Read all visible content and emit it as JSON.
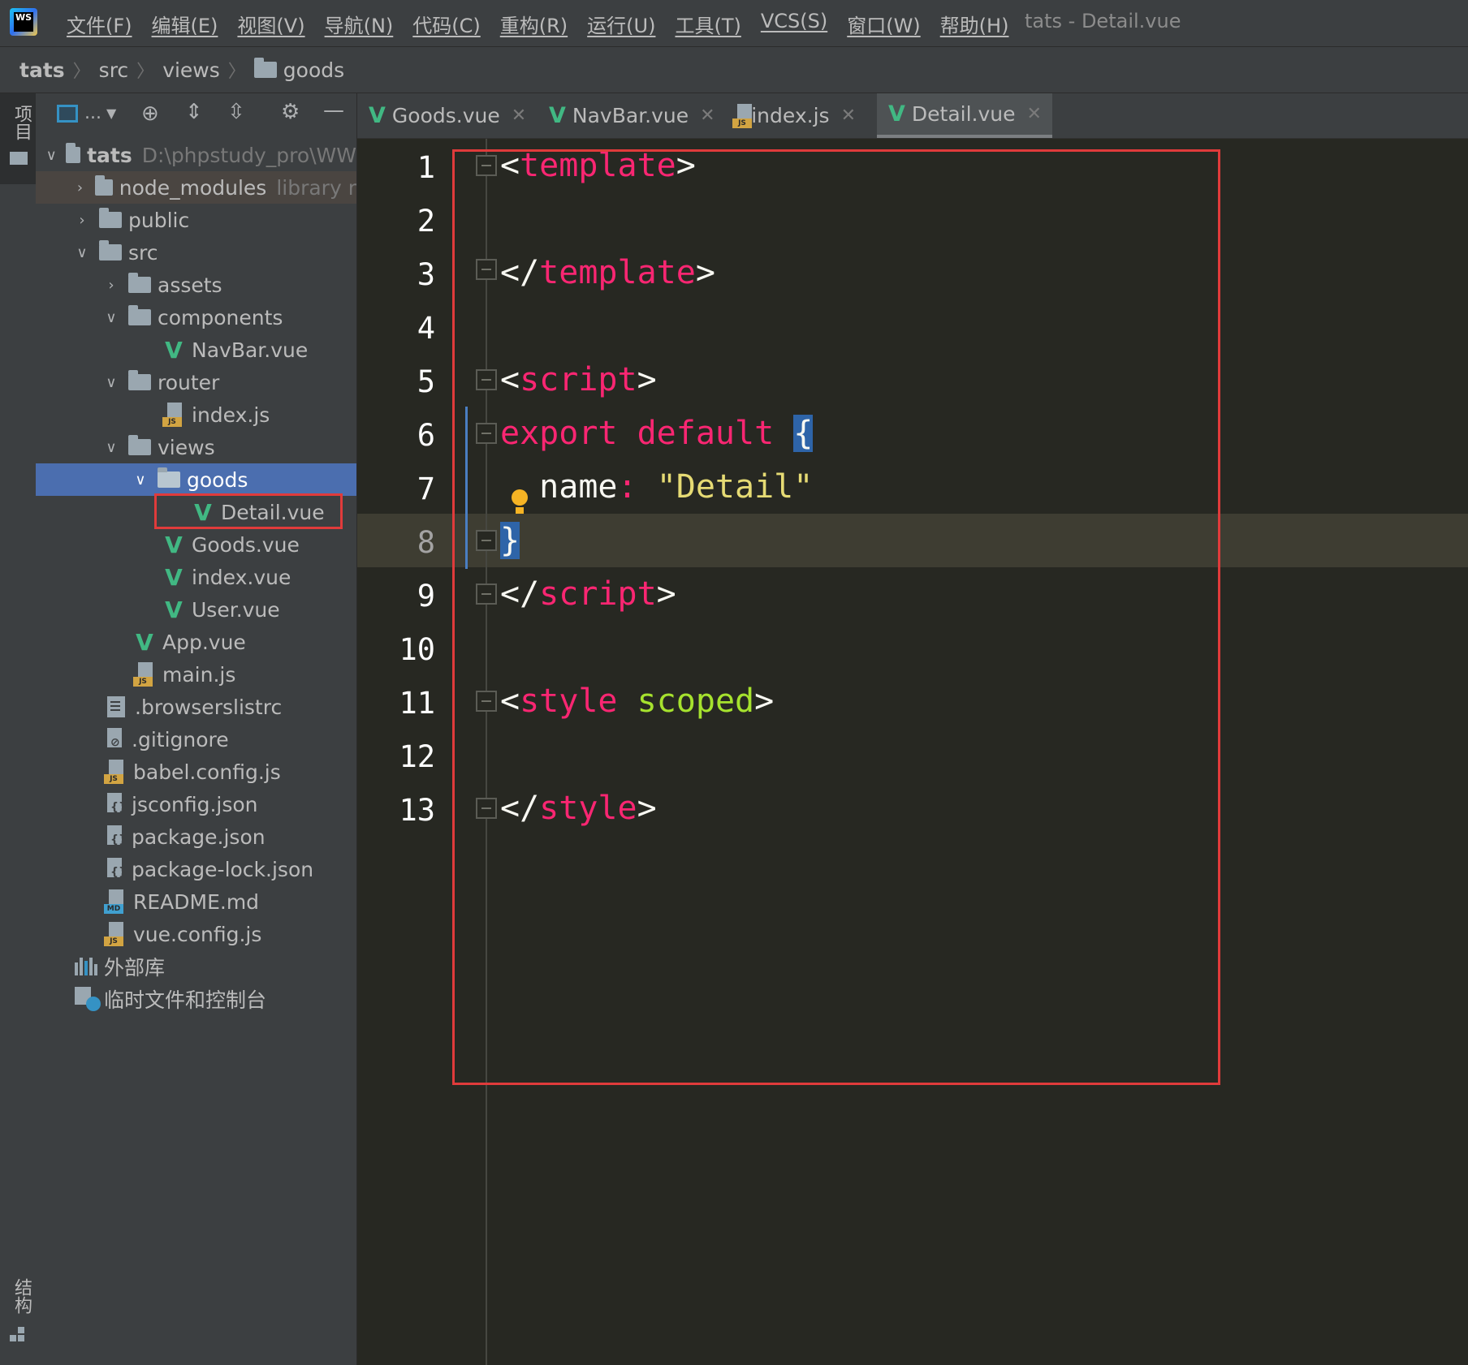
{
  "menubar": {
    "logo_text": "WS",
    "items": [
      "文件(F)",
      "编辑(E)",
      "视图(V)",
      "导航(N)",
      "代码(C)",
      "重构(R)",
      "运行(U)",
      "工具(T)",
      "VCS(S)",
      "窗口(W)",
      "帮助(H)"
    ],
    "window_title": "tats - Detail.vue"
  },
  "breadcrumb": [
    "tats",
    "src",
    "views",
    "goods"
  ],
  "toolstrip": {
    "project_label": "项目",
    "structure_label": "结构"
  },
  "project_toolbar": {
    "dropdown_label": "..."
  },
  "tree": {
    "root": {
      "name": "tats",
      "path": "D:\\phpstudy_pro\\WW"
    },
    "node_modules": {
      "name": "node_modules",
      "hint": "library r"
    },
    "public": "public",
    "src": "src",
    "assets": "assets",
    "components": "components",
    "navbar": "NavBar.vue",
    "router": "router",
    "router_index": "index.js",
    "views": "views",
    "goods": "goods",
    "detail": "Detail.vue",
    "goods_vue": "Goods.vue",
    "index_vue": "index.vue",
    "user_vue": "User.vue",
    "app_vue": "App.vue",
    "main_js": "main.js",
    "browserslistrc": ".browserslistrc",
    "gitignore": ".gitignore",
    "babel": "babel.config.js",
    "jsconfig": "jsconfig.json",
    "package": "package.json",
    "package_lock": "package-lock.json",
    "readme": "README.md",
    "vue_config": "vue.config.js",
    "external_libs": "外部库",
    "scratches": "临时文件和控制台",
    "js_tag": "JS",
    "md_tag": "MD"
  },
  "tabs": [
    {
      "label": "Goods.vue",
      "type": "vue",
      "active": false
    },
    {
      "label": "NavBar.vue",
      "type": "vue",
      "active": false
    },
    {
      "label": "index.js",
      "type": "js",
      "active": false
    },
    {
      "label": "Detail.vue",
      "type": "vue",
      "active": true
    }
  ],
  "editor": {
    "line_numbers": [
      "1",
      "2",
      "3",
      "4",
      "5",
      "6",
      "7",
      "8",
      "9",
      "10",
      "11",
      "12",
      "13"
    ],
    "current_line": 8,
    "code": {
      "l1_open": "<",
      "l1_tag": "template",
      "l1_close": ">",
      "l3_open": "</",
      "l3_tag": "template",
      "l3_close": ">",
      "l5_open": "<",
      "l5_tag": "script",
      "l5_close": ">",
      "l6_kw1": "export",
      "l6_kw2": "default",
      "l6_brace": "{",
      "l7_key": "name",
      "l7_colon": ":",
      "l7_str": "\"Detail\"",
      "l8_brace": "}",
      "l9_open": "</",
      "l9_tag": "script",
      "l9_close": ">",
      "l11_open": "<",
      "l11_tag": "style",
      "l11_attr": "scoped",
      "l11_close": ">",
      "l13_open": "</",
      "l13_tag": "style",
      "l13_close": ">"
    }
  },
  "colors": {
    "keyword": "#f92672",
    "string": "#e6db74",
    "attribute": "#a6e22e",
    "highlight_box": "#e03b3b",
    "selection": "#4b6eaf"
  }
}
